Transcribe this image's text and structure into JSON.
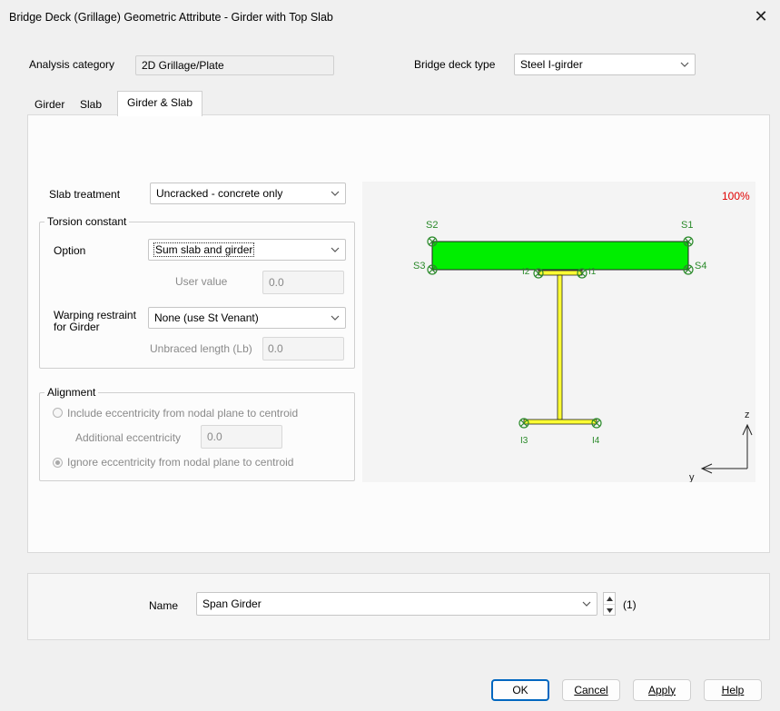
{
  "window": {
    "title": "Bridge Deck (Grillage) Geometric Attribute - Girder with Top Slab"
  },
  "header": {
    "analysis_label": "Analysis category",
    "analysis_value": "2D Grillage/Plate",
    "deck_type_label": "Bridge deck type",
    "deck_type_value": "Steel I-girder"
  },
  "tabs": [
    {
      "label": "Girder"
    },
    {
      "label": "Slab"
    },
    {
      "label": "Girder & Slab"
    }
  ],
  "form": {
    "slab_treatment_label": "Slab treatment",
    "slab_treatment_value": "Uncracked - concrete only",
    "torsion": {
      "title": "Torsion constant",
      "option_label": "Option",
      "option_value": "Sum slab and girder",
      "user_value_label": "User value",
      "user_value": "0.0",
      "warping_label_1": "Warping restraint",
      "warping_label_2": "for Girder",
      "warping_value": "None (use St Venant)",
      "unbraced_label": "Unbraced length (Lb)",
      "unbraced_value": "0.0"
    },
    "alignment": {
      "title": "Alignment",
      "include_label": "Include eccentricity from nodal plane to centroid",
      "additional_label": "Additional eccentricity",
      "additional_value": "0.0",
      "ignore_label": "Ignore eccentricity from nodal plane to centroid",
      "selected": "ignore"
    }
  },
  "preview": {
    "zoom": "100%",
    "points": {
      "s1": "S1",
      "s2": "S2",
      "s3": "S3",
      "s4": "S4",
      "i1": "I1",
      "i2": "I2",
      "i3": "I3",
      "i4": "I4"
    },
    "axis_z": "z",
    "axis_y": "y",
    "colors": {
      "slab": "#00ee00",
      "girder": "#ffff33",
      "point": "#2a8a2a",
      "zoom": "#e00000"
    }
  },
  "name_row": {
    "label": "Name",
    "value": "Span Girder",
    "count": "(1)"
  },
  "buttons": {
    "ok": "OK",
    "cancel": "Cancel",
    "apply": "Apply",
    "help": "Help"
  }
}
